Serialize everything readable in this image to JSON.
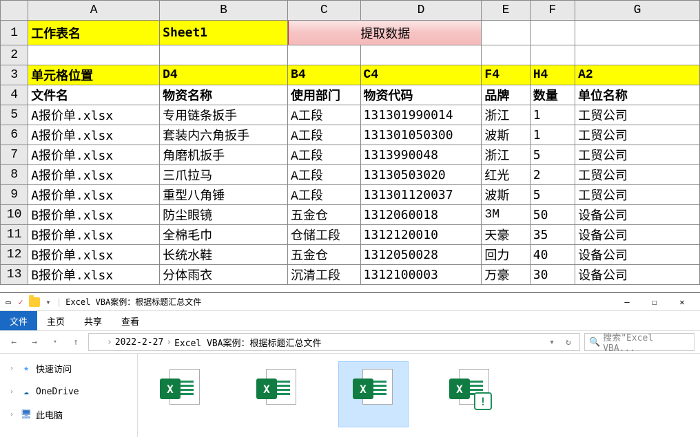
{
  "sheet": {
    "columns": [
      "A",
      "B",
      "C",
      "D",
      "E",
      "F",
      "G"
    ],
    "row1": {
      "label": "工作表名",
      "sheet_name": "Sheet1",
      "button": "提取数据"
    },
    "row3": {
      "label": "单元格位置",
      "B": "D4",
      "C": "B4",
      "D": "C4",
      "E": "F4",
      "F": "H4",
      "G": "A2"
    },
    "row4": {
      "label": "文件名",
      "B": "物资名称",
      "C": "使用部门",
      "D": "物资代码",
      "E": "品牌",
      "F": "数量",
      "G": "单位名称"
    },
    "rows": [
      {
        "n": 5,
        "A": "A报价单.xlsx",
        "B": "专用链条扳手",
        "C": "A工段",
        "D": "131301990014",
        "E": "浙江",
        "F": "1",
        "G": "工贸公司"
      },
      {
        "n": 6,
        "A": "A报价单.xlsx",
        "B": "套装内六角扳手",
        "C": "A工段",
        "D": "131301050300",
        "E": "波斯",
        "F": "1",
        "G": "工贸公司"
      },
      {
        "n": 7,
        "A": "A报价单.xlsx",
        "B": "角磨机扳手",
        "C": "A工段",
        "D": "1313990048",
        "E": "浙江",
        "F": "5",
        "G": "工贸公司"
      },
      {
        "n": 8,
        "A": "A报价单.xlsx",
        "B": "三爪拉马",
        "C": "A工段",
        "D": "13130503020",
        "E": "红光",
        "F": "2",
        "G": "工贸公司"
      },
      {
        "n": 9,
        "A": "A报价单.xlsx",
        "B": "重型八角锤",
        "C": "A工段",
        "D": "131301120037",
        "E": "波斯",
        "F": "5",
        "G": "工贸公司"
      },
      {
        "n": 10,
        "A": "B报价单.xlsx",
        "B": "防尘眼镜",
        "C": "五金仓",
        "D": "1312060018",
        "E": "3M",
        "F": "50",
        "G": "设备公司"
      },
      {
        "n": 11,
        "A": "B报价单.xlsx",
        "B": "全棉毛巾",
        "C": "仓储工段",
        "D": "1312120010",
        "E": "天豪",
        "F": "35",
        "G": "设备公司"
      },
      {
        "n": 12,
        "A": "B报价单.xlsx",
        "B": "长统水鞋",
        "C": "五金仓",
        "D": "1312050028",
        "E": "回力",
        "F": "40",
        "G": "设备公司"
      },
      {
        "n": 13,
        "A": "B报价单.xlsx",
        "B": "分体雨衣",
        "C": "沉清工段",
        "D": "1312100003",
        "E": "万豪",
        "F": "30",
        "G": "设备公司"
      }
    ]
  },
  "explorer": {
    "title": "Excel VBA案例：根据标题汇总文件",
    "tabs": {
      "file": "文件",
      "home": "主页",
      "share": "共享",
      "view": "查看"
    },
    "breadcrumb": [
      "2022-2-27",
      "Excel VBA案例：根据标题汇总文件"
    ],
    "search_placeholder": "搜索\"Excel VBA...",
    "sidebar": {
      "quick": "快速访问",
      "onedrive": "OneDrive",
      "thispc": "此电脑"
    },
    "files": [
      {
        "name": "",
        "overlay": false
      },
      {
        "name": "",
        "overlay": false
      },
      {
        "name": "",
        "overlay": false,
        "sel": true
      },
      {
        "name": "",
        "overlay": true
      }
    ]
  }
}
